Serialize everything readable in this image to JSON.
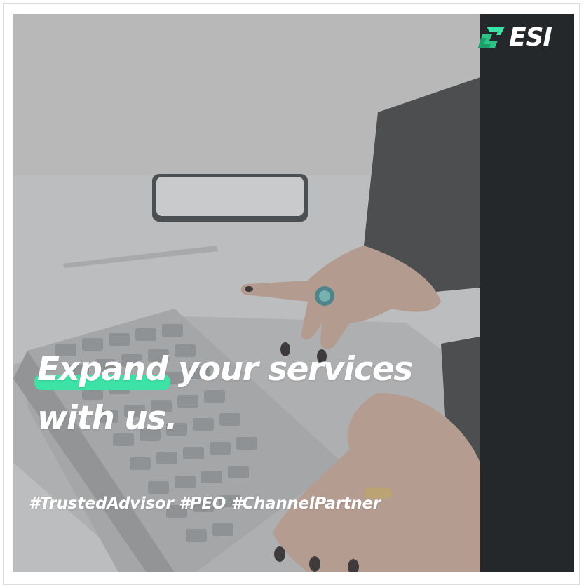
{
  "brand": {
    "name": "ESI",
    "accent_color": "#3de2a6",
    "sidebar_color": "#24282b"
  },
  "headline": {
    "highlighted_word": "Expand",
    "rest_line1": "your services",
    "line2": "with us."
  },
  "hashtags": "#TrustedAdvisor #PEO #ChannelPartner",
  "photo": {
    "icons": [
      "laptop-keyboard",
      "smartphone",
      "pen",
      "hand-with-ring"
    ]
  }
}
